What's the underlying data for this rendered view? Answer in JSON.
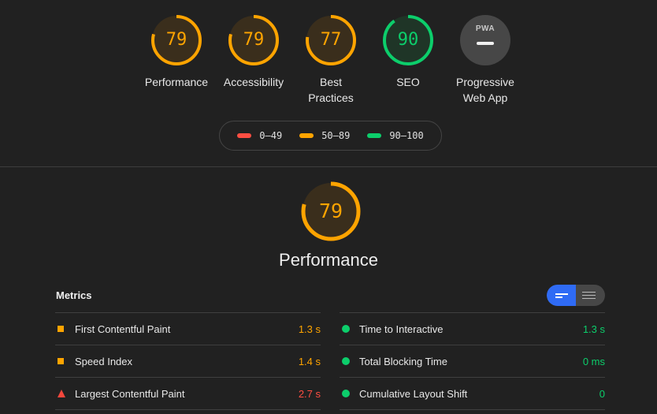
{
  "colors": {
    "orange": "#ffa400",
    "green": "#0cce6b",
    "red": "#ff4e42",
    "orange_bg": "#3a2e1c",
    "green_bg": "#1f3527"
  },
  "categories": [
    {
      "score": "79",
      "label_lines": [
        "Performance"
      ],
      "fraction": 0.79,
      "status": "average"
    },
    {
      "score": "79",
      "label_lines": [
        "Accessibility"
      ],
      "fraction": 0.79,
      "status": "average"
    },
    {
      "score": "77",
      "label_lines": [
        "Best",
        "Practices"
      ],
      "fraction": 0.77,
      "status": "average"
    },
    {
      "score": "90",
      "label_lines": [
        "SEO"
      ],
      "fraction": 0.9,
      "status": "pass"
    }
  ],
  "pwa": {
    "badge_text": "PWA",
    "label_lines": [
      "Progressive",
      "Web App"
    ]
  },
  "legend": [
    {
      "range": "0–49",
      "color": "#ff4e42"
    },
    {
      "range": "50–89",
      "color": "#ffa400"
    },
    {
      "range": "90–100",
      "color": "#0cce6b"
    }
  ],
  "performance": {
    "score": "79",
    "fraction": 0.79,
    "title": "Performance"
  },
  "metrics": {
    "title": "Metrics",
    "left": [
      {
        "name": "First Contentful Paint",
        "value": "1.3 s",
        "status": "average"
      },
      {
        "name": "Speed Index",
        "value": "1.4 s",
        "status": "average"
      },
      {
        "name": "Largest Contentful Paint",
        "value": "2.7 s",
        "status": "fail"
      }
    ],
    "right": [
      {
        "name": "Time to Interactive",
        "value": "1.3 s",
        "status": "pass"
      },
      {
        "name": "Total Blocking Time",
        "value": "0 ms",
        "status": "pass"
      },
      {
        "name": "Cumulative Layout Shift",
        "value": "0",
        "status": "pass"
      }
    ]
  },
  "icons": {
    "metric_average": "orange-square-icon",
    "metric_fail": "red-triangle-icon",
    "metric_pass": "green-circle-icon",
    "toggle_compact": "compact-view-icon",
    "toggle_expanded": "expanded-view-icon"
  }
}
